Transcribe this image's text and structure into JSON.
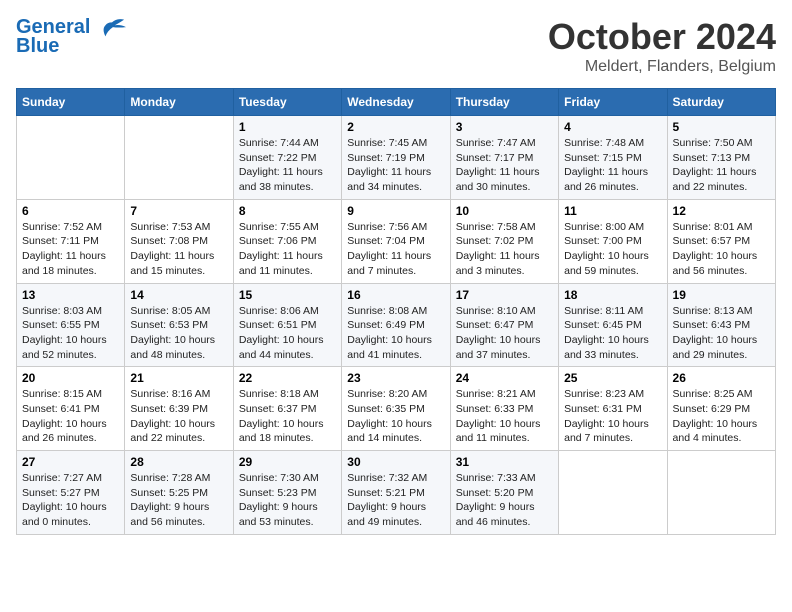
{
  "header": {
    "logo_line1": "General",
    "logo_line2": "Blue",
    "month": "October 2024",
    "location": "Meldert, Flanders, Belgium"
  },
  "weekdays": [
    "Sunday",
    "Monday",
    "Tuesday",
    "Wednesday",
    "Thursday",
    "Friday",
    "Saturday"
  ],
  "weeks": [
    [
      {
        "day": "",
        "sunrise": "",
        "sunset": "",
        "daylight": ""
      },
      {
        "day": "",
        "sunrise": "",
        "sunset": "",
        "daylight": ""
      },
      {
        "day": "1",
        "sunrise": "Sunrise: 7:44 AM",
        "sunset": "Sunset: 7:22 PM",
        "daylight": "Daylight: 11 hours and 38 minutes."
      },
      {
        "day": "2",
        "sunrise": "Sunrise: 7:45 AM",
        "sunset": "Sunset: 7:19 PM",
        "daylight": "Daylight: 11 hours and 34 minutes."
      },
      {
        "day": "3",
        "sunrise": "Sunrise: 7:47 AM",
        "sunset": "Sunset: 7:17 PM",
        "daylight": "Daylight: 11 hours and 30 minutes."
      },
      {
        "day": "4",
        "sunrise": "Sunrise: 7:48 AM",
        "sunset": "Sunset: 7:15 PM",
        "daylight": "Daylight: 11 hours and 26 minutes."
      },
      {
        "day": "5",
        "sunrise": "Sunrise: 7:50 AM",
        "sunset": "Sunset: 7:13 PM",
        "daylight": "Daylight: 11 hours and 22 minutes."
      }
    ],
    [
      {
        "day": "6",
        "sunrise": "Sunrise: 7:52 AM",
        "sunset": "Sunset: 7:11 PM",
        "daylight": "Daylight: 11 hours and 18 minutes."
      },
      {
        "day": "7",
        "sunrise": "Sunrise: 7:53 AM",
        "sunset": "Sunset: 7:08 PM",
        "daylight": "Daylight: 11 hours and 15 minutes."
      },
      {
        "day": "8",
        "sunrise": "Sunrise: 7:55 AM",
        "sunset": "Sunset: 7:06 PM",
        "daylight": "Daylight: 11 hours and 11 minutes."
      },
      {
        "day": "9",
        "sunrise": "Sunrise: 7:56 AM",
        "sunset": "Sunset: 7:04 PM",
        "daylight": "Daylight: 11 hours and 7 minutes."
      },
      {
        "day": "10",
        "sunrise": "Sunrise: 7:58 AM",
        "sunset": "Sunset: 7:02 PM",
        "daylight": "Daylight: 11 hours and 3 minutes."
      },
      {
        "day": "11",
        "sunrise": "Sunrise: 8:00 AM",
        "sunset": "Sunset: 7:00 PM",
        "daylight": "Daylight: 10 hours and 59 minutes."
      },
      {
        "day": "12",
        "sunrise": "Sunrise: 8:01 AM",
        "sunset": "Sunset: 6:57 PM",
        "daylight": "Daylight: 10 hours and 56 minutes."
      }
    ],
    [
      {
        "day": "13",
        "sunrise": "Sunrise: 8:03 AM",
        "sunset": "Sunset: 6:55 PM",
        "daylight": "Daylight: 10 hours and 52 minutes."
      },
      {
        "day": "14",
        "sunrise": "Sunrise: 8:05 AM",
        "sunset": "Sunset: 6:53 PM",
        "daylight": "Daylight: 10 hours and 48 minutes."
      },
      {
        "day": "15",
        "sunrise": "Sunrise: 8:06 AM",
        "sunset": "Sunset: 6:51 PM",
        "daylight": "Daylight: 10 hours and 44 minutes."
      },
      {
        "day": "16",
        "sunrise": "Sunrise: 8:08 AM",
        "sunset": "Sunset: 6:49 PM",
        "daylight": "Daylight: 10 hours and 41 minutes."
      },
      {
        "day": "17",
        "sunrise": "Sunrise: 8:10 AM",
        "sunset": "Sunset: 6:47 PM",
        "daylight": "Daylight: 10 hours and 37 minutes."
      },
      {
        "day": "18",
        "sunrise": "Sunrise: 8:11 AM",
        "sunset": "Sunset: 6:45 PM",
        "daylight": "Daylight: 10 hours and 33 minutes."
      },
      {
        "day": "19",
        "sunrise": "Sunrise: 8:13 AM",
        "sunset": "Sunset: 6:43 PM",
        "daylight": "Daylight: 10 hours and 29 minutes."
      }
    ],
    [
      {
        "day": "20",
        "sunrise": "Sunrise: 8:15 AM",
        "sunset": "Sunset: 6:41 PM",
        "daylight": "Daylight: 10 hours and 26 minutes."
      },
      {
        "day": "21",
        "sunrise": "Sunrise: 8:16 AM",
        "sunset": "Sunset: 6:39 PM",
        "daylight": "Daylight: 10 hours and 22 minutes."
      },
      {
        "day": "22",
        "sunrise": "Sunrise: 8:18 AM",
        "sunset": "Sunset: 6:37 PM",
        "daylight": "Daylight: 10 hours and 18 minutes."
      },
      {
        "day": "23",
        "sunrise": "Sunrise: 8:20 AM",
        "sunset": "Sunset: 6:35 PM",
        "daylight": "Daylight: 10 hours and 14 minutes."
      },
      {
        "day": "24",
        "sunrise": "Sunrise: 8:21 AM",
        "sunset": "Sunset: 6:33 PM",
        "daylight": "Daylight: 10 hours and 11 minutes."
      },
      {
        "day": "25",
        "sunrise": "Sunrise: 8:23 AM",
        "sunset": "Sunset: 6:31 PM",
        "daylight": "Daylight: 10 hours and 7 minutes."
      },
      {
        "day": "26",
        "sunrise": "Sunrise: 8:25 AM",
        "sunset": "Sunset: 6:29 PM",
        "daylight": "Daylight: 10 hours and 4 minutes."
      }
    ],
    [
      {
        "day": "27",
        "sunrise": "Sunrise: 7:27 AM",
        "sunset": "Sunset: 5:27 PM",
        "daylight": "Daylight: 10 hours and 0 minutes."
      },
      {
        "day": "28",
        "sunrise": "Sunrise: 7:28 AM",
        "sunset": "Sunset: 5:25 PM",
        "daylight": "Daylight: 9 hours and 56 minutes."
      },
      {
        "day": "29",
        "sunrise": "Sunrise: 7:30 AM",
        "sunset": "Sunset: 5:23 PM",
        "daylight": "Daylight: 9 hours and 53 minutes."
      },
      {
        "day": "30",
        "sunrise": "Sunrise: 7:32 AM",
        "sunset": "Sunset: 5:21 PM",
        "daylight": "Daylight: 9 hours and 49 minutes."
      },
      {
        "day": "31",
        "sunrise": "Sunrise: 7:33 AM",
        "sunset": "Sunset: 5:20 PM",
        "daylight": "Daylight: 9 hours and 46 minutes."
      },
      {
        "day": "",
        "sunrise": "",
        "sunset": "",
        "daylight": ""
      },
      {
        "day": "",
        "sunrise": "",
        "sunset": "",
        "daylight": ""
      }
    ]
  ]
}
